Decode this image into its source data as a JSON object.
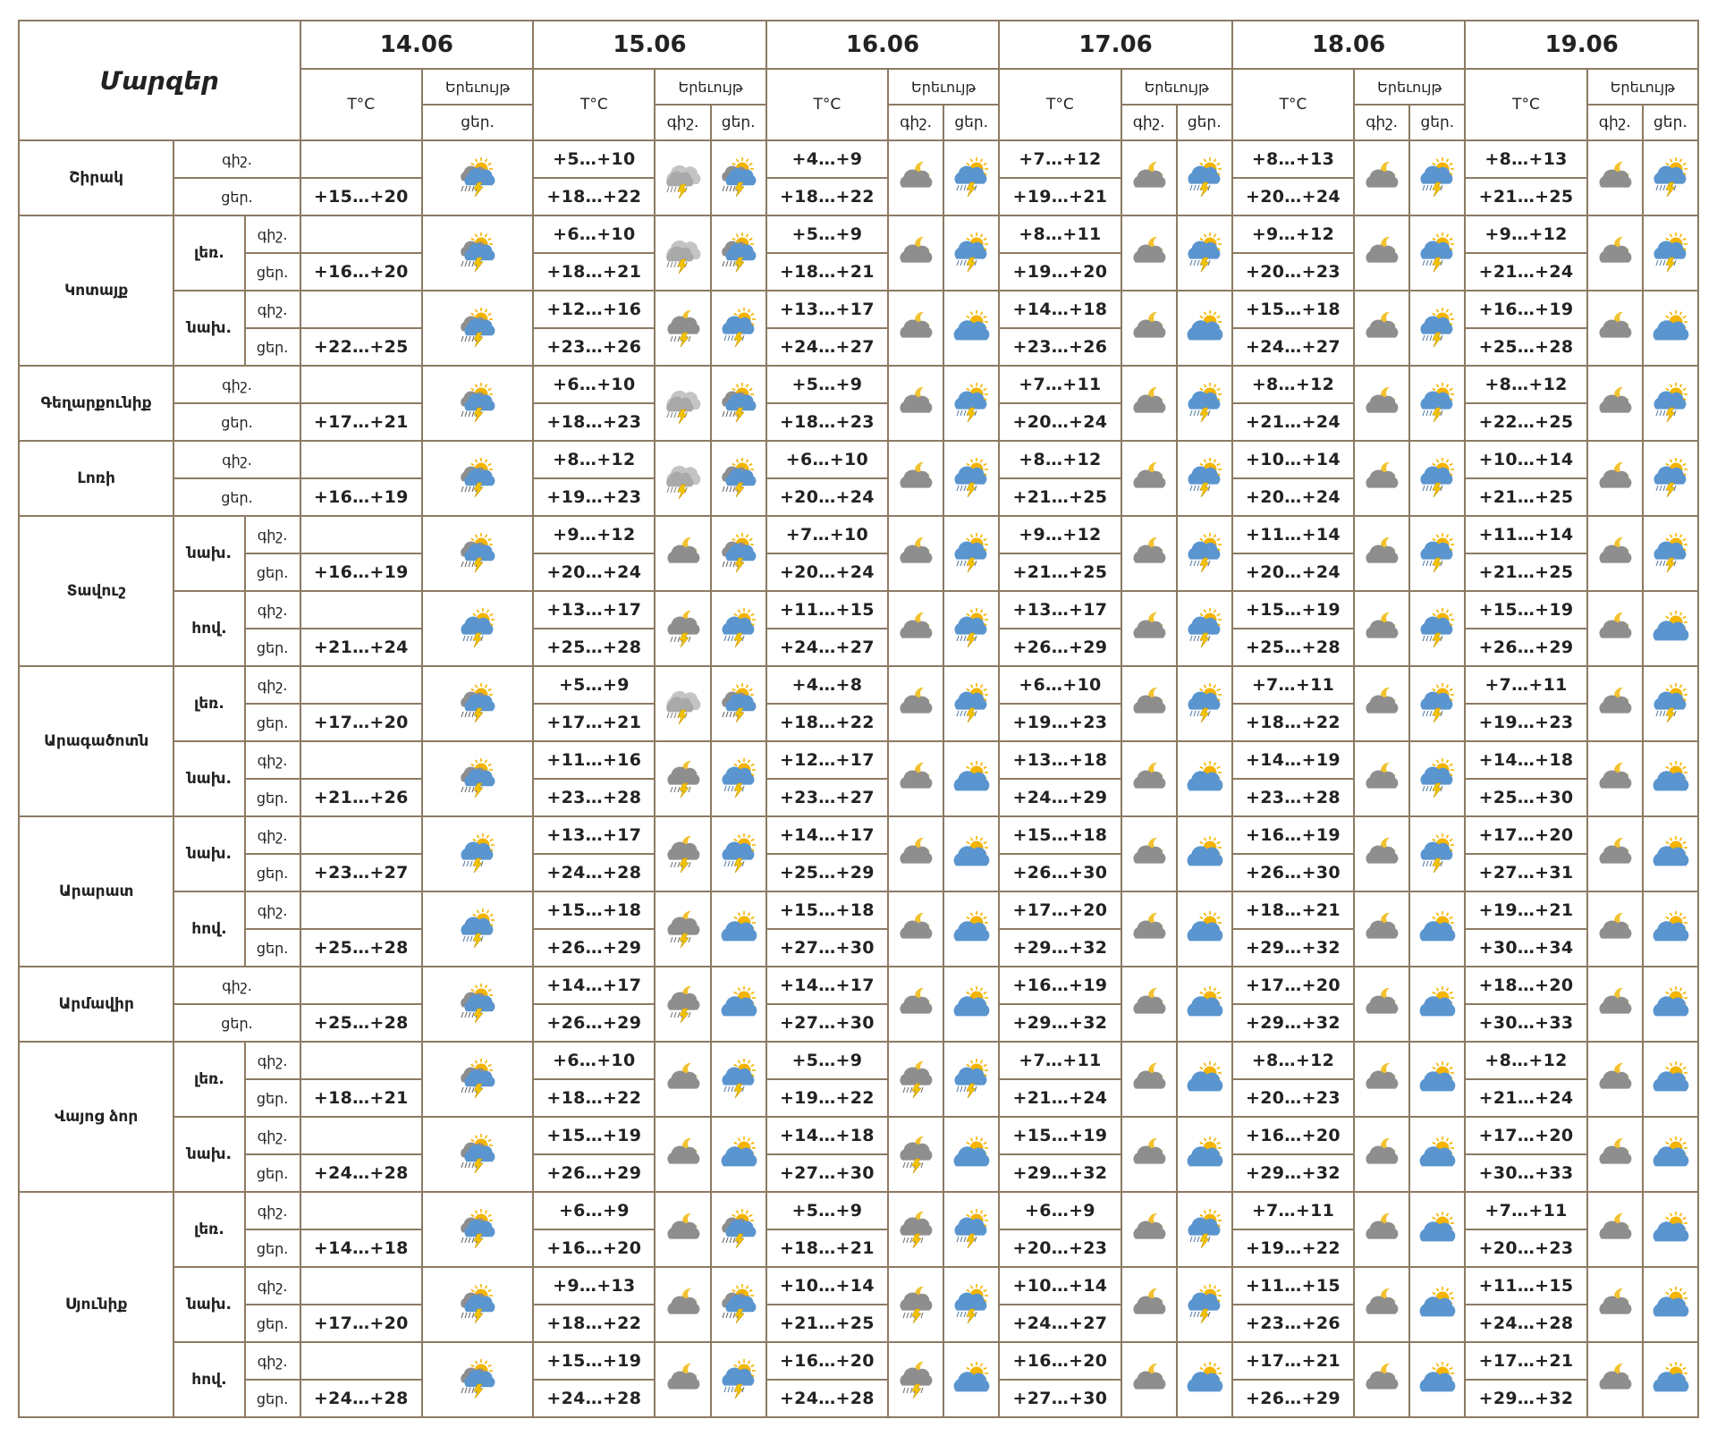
{
  "header": {
    "regions_label": "Մարզեր",
    "temp_label": "T°C",
    "phenomenon_label": "Երեւույթ",
    "night_label": "գիշ.",
    "day_label": "ցեր.",
    "dates": [
      "14.06",
      "15.06",
      "16.06",
      "17.06",
      "18.06",
      "19.06"
    ]
  },
  "rows": [
    {
      "region": "Շիրակ",
      "area": "",
      "temps": [
        [
          "",
          "+15…+20"
        ],
        [
          "+5…+10",
          "+18…+22"
        ],
        [
          "+4…+9",
          "+18…+22"
        ],
        [
          "+7…+12",
          "+19…+21"
        ],
        [
          "+8…+13",
          "+20…+24"
        ],
        [
          "+8…+13",
          "+21…+25"
        ]
      ],
      "icons": [
        [
          "rain-thunder-icon"
        ],
        [
          "cloudy-rain-icon",
          "rain-thunder-icon"
        ],
        [
          "moon-cloud-icon",
          "sun-cloud-rain-thunder-icon"
        ],
        [
          "moon-cloud-icon",
          "sun-cloud-rain-thunder-icon"
        ],
        [
          "moon-cloud-icon",
          "sun-cloud-rain-thunder-icon"
        ],
        [
          "moon-cloud-icon",
          "sun-cloud-rain-thunder-icon"
        ]
      ]
    },
    {
      "region": "Կոտայք",
      "area": "լեռ.",
      "temps": [
        [
          "",
          "+16…+20"
        ],
        [
          "+6…+10",
          "+18…+21"
        ],
        [
          "+5…+9",
          "+18…+21"
        ],
        [
          "+8…+11",
          "+19…+20"
        ],
        [
          "+9…+12",
          "+20…+23"
        ],
        [
          "+9…+12",
          "+21…+24"
        ]
      ],
      "icons": [
        [
          "rain-thunder-icon"
        ],
        [
          "cloudy-rain-icon",
          "rain-thunder-icon"
        ],
        [
          "moon-cloud-icon",
          "sun-cloud-rain-thunder-icon"
        ],
        [
          "moon-cloud-icon",
          "sun-cloud-rain-thunder-icon"
        ],
        [
          "moon-cloud-icon",
          "sun-cloud-rain-thunder-icon"
        ],
        [
          "moon-cloud-icon",
          "sun-cloud-rain-thunder-icon"
        ]
      ]
    },
    {
      "region": "",
      "area": "նախ.",
      "temps": [
        [
          "",
          "+22…+25"
        ],
        [
          "+12…+16",
          "+23…+26"
        ],
        [
          "+13…+17",
          "+24…+27"
        ],
        [
          "+14…+18",
          "+23…+26"
        ],
        [
          "+15…+18",
          "+24…+27"
        ],
        [
          "+16…+19",
          "+25…+28"
        ]
      ],
      "icons": [
        [
          "rain-thunder-icon"
        ],
        [
          "moon-cloud-rain-thunder-icon",
          "sun-cloud-rain-thunder-icon"
        ],
        [
          "moon-cloud-icon",
          "sun-cloud-icon"
        ],
        [
          "moon-cloud-icon",
          "sun-cloud-icon"
        ],
        [
          "moon-cloud-icon",
          "sun-cloud-rain-thunder-icon"
        ],
        [
          "moon-cloud-icon",
          "sun-cloud-icon"
        ]
      ]
    },
    {
      "region": "Գեղարքունիք",
      "area": "",
      "temps": [
        [
          "",
          "+17…+21"
        ],
        [
          "+6…+10",
          "+18…+23"
        ],
        [
          "+5…+9",
          "+18…+23"
        ],
        [
          "+7…+11",
          "+20…+24"
        ],
        [
          "+8…+12",
          "+21…+24"
        ],
        [
          "+8…+12",
          "+22…+25"
        ]
      ],
      "icons": [
        [
          "rain-thunder-icon"
        ],
        [
          "cloudy-rain-icon",
          "rain-thunder-icon"
        ],
        [
          "moon-cloud-icon",
          "sun-cloud-rain-thunder-icon"
        ],
        [
          "moon-cloud-icon",
          "sun-cloud-rain-thunder-icon"
        ],
        [
          "moon-cloud-icon",
          "sun-cloud-rain-thunder-icon"
        ],
        [
          "moon-cloud-icon",
          "sun-cloud-rain-thunder-icon"
        ]
      ]
    },
    {
      "region": "Լոռի",
      "area": "",
      "temps": [
        [
          "",
          "+16…+19"
        ],
        [
          "+8…+12",
          "+19…+23"
        ],
        [
          "+6…+10",
          "+20…+24"
        ],
        [
          "+8…+12",
          "+21…+25"
        ],
        [
          "+10…+14",
          "+20…+24"
        ],
        [
          "+10…+14",
          "+21…+25"
        ]
      ],
      "icons": [
        [
          "rain-thunder-icon"
        ],
        [
          "cloudy-rain-icon",
          "rain-thunder-icon"
        ],
        [
          "moon-cloud-icon",
          "sun-cloud-rain-thunder-icon"
        ],
        [
          "moon-cloud-icon",
          "sun-cloud-rain-thunder-icon"
        ],
        [
          "moon-cloud-icon",
          "sun-cloud-rain-thunder-icon"
        ],
        [
          "moon-cloud-icon",
          "sun-cloud-rain-thunder-icon"
        ]
      ]
    },
    {
      "region": "Տավուշ",
      "area": "նախ.",
      "temps": [
        [
          "",
          "+16…+19"
        ],
        [
          "+9…+12",
          "+20…+24"
        ],
        [
          "+7…+10",
          "+20…+24"
        ],
        [
          "+9…+12",
          "+21…+25"
        ],
        [
          "+11…+14",
          "+20…+24"
        ],
        [
          "+11…+14",
          "+21…+25"
        ]
      ],
      "icons": [
        [
          "rain-thunder-icon"
        ],
        [
          "moon-cloud-icon",
          "rain-thunder-icon"
        ],
        [
          "moon-cloud-icon",
          "sun-cloud-rain-thunder-icon"
        ],
        [
          "moon-cloud-icon",
          "sun-cloud-rain-thunder-icon"
        ],
        [
          "moon-cloud-icon",
          "sun-cloud-rain-thunder-icon"
        ],
        [
          "moon-cloud-icon",
          "sun-cloud-rain-thunder-icon"
        ]
      ]
    },
    {
      "region": "",
      "area": "հով.",
      "temps": [
        [
          "",
          "+21…+24"
        ],
        [
          "+13…+17",
          "+25…+28"
        ],
        [
          "+11…+15",
          "+24…+27"
        ],
        [
          "+13…+17",
          "+26…+29"
        ],
        [
          "+15…+19",
          "+25…+28"
        ],
        [
          "+15…+19",
          "+26…+29"
        ]
      ],
      "icons": [
        [
          "sun-cloud-rain-thunder-icon"
        ],
        [
          "moon-cloud-rain-thunder-icon",
          "sun-cloud-rain-thunder-icon"
        ],
        [
          "moon-cloud-icon",
          "sun-cloud-rain-thunder-icon"
        ],
        [
          "moon-cloud-icon",
          "sun-cloud-rain-thunder-icon"
        ],
        [
          "moon-cloud-icon",
          "sun-cloud-rain-thunder-icon"
        ],
        [
          "moon-cloud-icon",
          "sun-cloud-icon"
        ]
      ]
    },
    {
      "region": "Արագածոտն",
      "area": "լեռ.",
      "temps": [
        [
          "",
          "+17…+20"
        ],
        [
          "+5…+9",
          "+17…+21"
        ],
        [
          "+4…+8",
          "+18…+22"
        ],
        [
          "+6…+10",
          "+19…+23"
        ],
        [
          "+7…+11",
          "+18…+22"
        ],
        [
          "+7…+11",
          "+19…+23"
        ]
      ],
      "icons": [
        [
          "rain-thunder-icon"
        ],
        [
          "cloudy-rain-icon",
          "rain-thunder-icon"
        ],
        [
          "moon-cloud-icon",
          "sun-cloud-rain-thunder-icon"
        ],
        [
          "moon-cloud-icon",
          "sun-cloud-rain-thunder-icon"
        ],
        [
          "moon-cloud-icon",
          "sun-cloud-rain-thunder-icon"
        ],
        [
          "moon-cloud-icon",
          "sun-cloud-rain-thunder-icon"
        ]
      ]
    },
    {
      "region": "",
      "area": "նախ.",
      "temps": [
        [
          "",
          "+21…+26"
        ],
        [
          "+11…+16",
          "+23…+28"
        ],
        [
          "+12…+17",
          "+23…+27"
        ],
        [
          "+13…+18",
          "+24…+29"
        ],
        [
          "+14…+19",
          "+23…+28"
        ],
        [
          "+14…+18",
          "+25…+30"
        ]
      ],
      "icons": [
        [
          "rain-thunder-icon"
        ],
        [
          "moon-cloud-rain-thunder-icon",
          "sun-cloud-rain-thunder-icon"
        ],
        [
          "moon-cloud-icon",
          "sun-cloud-icon"
        ],
        [
          "moon-cloud-icon",
          "sun-cloud-icon"
        ],
        [
          "moon-cloud-icon",
          "sun-cloud-rain-thunder-icon"
        ],
        [
          "moon-cloud-icon",
          "sun-cloud-icon"
        ]
      ]
    },
    {
      "region": "Արարատ",
      "area": "նախ.",
      "temps": [
        [
          "",
          "+23…+27"
        ],
        [
          "+13…+17",
          "+24…+28"
        ],
        [
          "+14…+17",
          "+25…+29"
        ],
        [
          "+15…+18",
          "+26…+30"
        ],
        [
          "+16…+19",
          "+26…+30"
        ],
        [
          "+17…+20",
          "+27…+31"
        ]
      ],
      "icons": [
        [
          "sun-cloud-rain-thunder-icon"
        ],
        [
          "moon-cloud-rain-thunder-icon",
          "sun-cloud-rain-thunder-icon"
        ],
        [
          "moon-cloud-icon",
          "sun-cloud-icon"
        ],
        [
          "moon-cloud-icon",
          "sun-cloud-icon"
        ],
        [
          "moon-cloud-icon",
          "sun-cloud-rain-thunder-icon"
        ],
        [
          "moon-cloud-icon",
          "sun-cloud-icon"
        ]
      ]
    },
    {
      "region": "",
      "area": "հով.",
      "temps": [
        [
          "",
          "+25…+28"
        ],
        [
          "+15…+18",
          "+26…+29"
        ],
        [
          "+15…+18",
          "+27…+30"
        ],
        [
          "+17…+20",
          "+29…+32"
        ],
        [
          "+18…+21",
          "+29…+32"
        ],
        [
          "+19…+21",
          "+30…+34"
        ]
      ],
      "icons": [
        [
          "sun-cloud-rain-thunder-icon"
        ],
        [
          "moon-cloud-rain-thunder-icon",
          "sun-cloud-icon"
        ],
        [
          "moon-cloud-icon",
          "sun-cloud-icon"
        ],
        [
          "moon-cloud-icon",
          "sun-cloud-icon"
        ],
        [
          "moon-cloud-icon",
          "sun-cloud-icon"
        ],
        [
          "moon-cloud-icon",
          "sun-cloud-icon"
        ]
      ]
    },
    {
      "region": "Արմավիր",
      "area": "",
      "temps": [
        [
          "",
          "+25…+28"
        ],
        [
          "+14…+17",
          "+26…+29"
        ],
        [
          "+14…+17",
          "+27…+30"
        ],
        [
          "+16…+19",
          "+29…+32"
        ],
        [
          "+17…+20",
          "+29…+32"
        ],
        [
          "+18…+20",
          "+30…+33"
        ]
      ],
      "icons": [
        [
          "rain-thunder-icon"
        ],
        [
          "moon-cloud-rain-thunder-icon",
          "sun-cloud-icon"
        ],
        [
          "moon-cloud-icon",
          "sun-cloud-icon"
        ],
        [
          "moon-cloud-icon",
          "sun-cloud-icon"
        ],
        [
          "moon-cloud-icon",
          "sun-cloud-icon"
        ],
        [
          "moon-cloud-icon",
          "sun-cloud-icon"
        ]
      ]
    },
    {
      "region": "Վայոց ձոր",
      "area": "լեռ.",
      "temps": [
        [
          "",
          "+18…+21"
        ],
        [
          "+6…+10",
          "+18…+22"
        ],
        [
          "+5…+9",
          "+19…+22"
        ],
        [
          "+7…+11",
          "+21…+24"
        ],
        [
          "+8…+12",
          "+20…+23"
        ],
        [
          "+8…+12",
          "+21…+24"
        ]
      ],
      "icons": [
        [
          "rain-thunder-icon"
        ],
        [
          "moon-cloud-icon",
          "sun-cloud-rain-thunder-icon"
        ],
        [
          "moon-cloud-rain-thunder-icon",
          "sun-cloud-rain-thunder-icon"
        ],
        [
          "moon-cloud-icon",
          "sun-cloud-icon"
        ],
        [
          "moon-cloud-icon",
          "sun-cloud-icon"
        ],
        [
          "moon-cloud-icon",
          "sun-cloud-icon"
        ]
      ]
    },
    {
      "region": "",
      "area": "նախ.",
      "temps": [
        [
          "",
          "+24…+28"
        ],
        [
          "+15…+19",
          "+26…+29"
        ],
        [
          "+14…+18",
          "+27…+30"
        ],
        [
          "+15…+19",
          "+29…+32"
        ],
        [
          "+16…+20",
          "+29…+32"
        ],
        [
          "+17…+20",
          "+30…+33"
        ]
      ],
      "icons": [
        [
          "rain-thunder-icon"
        ],
        [
          "moon-cloud-icon",
          "sun-cloud-icon"
        ],
        [
          "moon-cloud-rain-thunder-icon",
          "sun-cloud-icon"
        ],
        [
          "moon-cloud-icon",
          "sun-cloud-icon"
        ],
        [
          "moon-cloud-icon",
          "sun-cloud-icon"
        ],
        [
          "moon-cloud-icon",
          "sun-cloud-icon"
        ]
      ]
    },
    {
      "region": "Սյունիք",
      "area": "լեռ.",
      "temps": [
        [
          "",
          "+14…+18"
        ],
        [
          "+6…+9",
          "+16…+20"
        ],
        [
          "+5…+9",
          "+18…+21"
        ],
        [
          "+6…+9",
          "+20…+23"
        ],
        [
          "+7…+11",
          "+19…+22"
        ],
        [
          "+7…+11",
          "+20…+23"
        ]
      ],
      "icons": [
        [
          "rain-thunder-icon"
        ],
        [
          "moon-cloud-icon",
          "rain-thunder-icon"
        ],
        [
          "moon-cloud-rain-thunder-icon",
          "sun-cloud-rain-thunder-icon"
        ],
        [
          "moon-cloud-icon",
          "sun-cloud-rain-thunder-icon"
        ],
        [
          "moon-cloud-icon",
          "sun-cloud-icon"
        ],
        [
          "moon-cloud-icon",
          "sun-cloud-icon"
        ]
      ]
    },
    {
      "region": "",
      "area": "նախ.",
      "temps": [
        [
          "",
          "+17…+20"
        ],
        [
          "+9…+13",
          "+18…+22"
        ],
        [
          "+10…+14",
          "+21…+25"
        ],
        [
          "+10…+14",
          "+24…+27"
        ],
        [
          "+11…+15",
          "+23…+26"
        ],
        [
          "+11…+15",
          "+24…+28"
        ]
      ],
      "icons": [
        [
          "rain-thunder-icon"
        ],
        [
          "moon-cloud-icon",
          "rain-thunder-icon"
        ],
        [
          "moon-cloud-rain-thunder-icon",
          "sun-cloud-rain-thunder-icon"
        ],
        [
          "moon-cloud-icon",
          "sun-cloud-rain-thunder-icon"
        ],
        [
          "moon-cloud-icon",
          "sun-cloud-icon"
        ],
        [
          "moon-cloud-icon",
          "sun-cloud-icon"
        ]
      ]
    },
    {
      "region": "",
      "area": "հով.",
      "temps": [
        [
          "",
          "+24…+28"
        ],
        [
          "+15…+19",
          "+24…+28"
        ],
        [
          "+16…+20",
          "+24…+28"
        ],
        [
          "+16…+20",
          "+27…+30"
        ],
        [
          "+17…+21",
          "+26…+29"
        ],
        [
          "+17…+21",
          "+29…+32"
        ]
      ],
      "icons": [
        [
          "rain-thunder-icon"
        ],
        [
          "moon-cloud-icon",
          "sun-cloud-rain-thunder-icon"
        ],
        [
          "moon-cloud-rain-thunder-icon",
          "sun-cloud-icon"
        ],
        [
          "moon-cloud-icon",
          "sun-cloud-icon"
        ],
        [
          "moon-cloud-icon",
          "sun-cloud-icon"
        ],
        [
          "moon-cloud-icon",
          "sun-cloud-icon"
        ]
      ]
    }
  ],
  "colors": {
    "border": "#8c7a63",
    "cloud_gray": "#8e8e8e",
    "cloud_blue": "#5a95cf",
    "sun": "#f4b400",
    "moon": "#f2c230",
    "rain": "#7a7a7a",
    "bolt": "#f4c400"
  }
}
